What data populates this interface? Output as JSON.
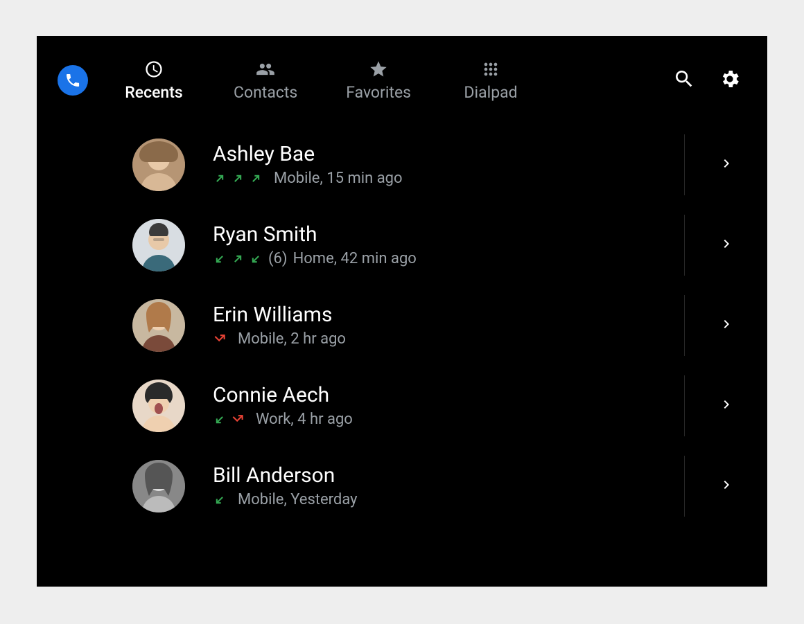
{
  "tabs": {
    "recents": {
      "label": "Recents",
      "active": true
    },
    "contacts": {
      "label": "Contacts",
      "active": false
    },
    "favorites": {
      "label": "Favorites",
      "active": false
    },
    "dialpad": {
      "label": "Dialpad",
      "active": false
    }
  },
  "calls": [
    {
      "name": "Ashley Bae",
      "arrows": [
        "out",
        "out",
        "out"
      ],
      "count_text": "",
      "detail": "Mobile, 15 min ago"
    },
    {
      "name": "Ryan Smith",
      "arrows": [
        "in",
        "out",
        "in"
      ],
      "count_text": "(6) ",
      "detail": "Home, 42 min ago"
    },
    {
      "name": "Erin Williams",
      "arrows": [
        "missed"
      ],
      "count_text": "",
      "detail": "Mobile, 2 hr ago"
    },
    {
      "name": "Connie Aech",
      "arrows": [
        "in",
        "missed"
      ],
      "count_text": "",
      "detail": "Work, 4 hr ago"
    },
    {
      "name": "Bill Anderson",
      "arrows": [
        "in"
      ],
      "count_text": "",
      "detail": "Mobile, Yesterday"
    }
  ]
}
